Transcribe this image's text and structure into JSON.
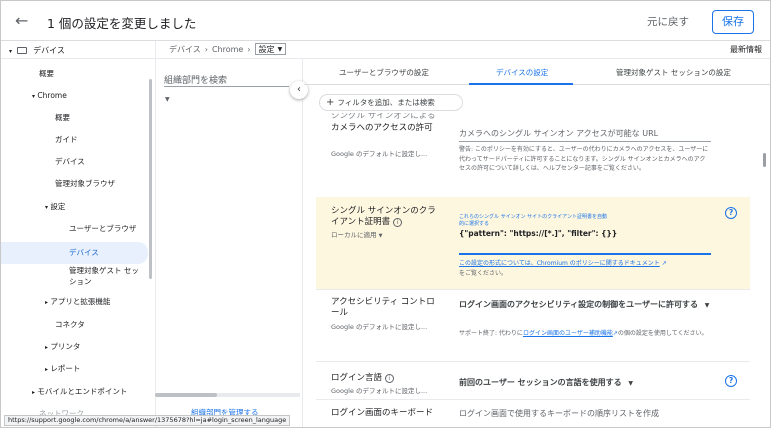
{
  "topbar": {
    "title": "1 個の設定を変更しました",
    "undo_label": "元に戻す",
    "save_label": "保存"
  },
  "breadcrumb": {
    "part1": "デバイス",
    "part2": "Chrome",
    "current": "設定"
  },
  "latest_info": "最新情報",
  "nav": {
    "devices": "デバイス",
    "overview": "概要",
    "chrome": "Chrome",
    "chrome_overview": "概要",
    "guide": "ガイド",
    "chrome_devices": "デバイス",
    "managed_browsers": "管理対象ブラウザ",
    "settings": "設定",
    "users_browsers": "ユーザーとブラウザ",
    "devices_settings": "デバイス",
    "managed_guest_1": "管理対象ゲスト セッ",
    "managed_guest_2": "ション",
    "apps_extensions": "アプリと拡張機能",
    "connectors": "コネクタ",
    "printers": "プリンタ",
    "reports": "レポート",
    "mobile_endpoints": "モバイルとエンドポイント",
    "network_partial": "ネットワーク"
  },
  "org": {
    "search_placeholder": "組織部門を検索",
    "manage_partial": "組織部門を管理する"
  },
  "tabs": {
    "tab1": "ユーザーとブラウザの設定",
    "tab2": "デバイスの設定",
    "tab3": "管理対象ゲスト セッションの設定"
  },
  "filter_label": "フィルタを追加、または検索",
  "settings": {
    "camera": {
      "name_partial": "シングル サインオンによる",
      "name_line2": "カメラへのアクセスの許可",
      "inherit": "Google のデフォルトに設定し...",
      "value": "カメラへのシングル サインオン アクセスが可能な URL",
      "warning": "警告: このポリシーを有効にすると、ユーザーの代わりにカメラへのアクセスを、ユーザーに代わってサードパーティに許可することになります。シングル サインオンとカメラへのアクセスの許可について詳しくは、ヘルプセンター記事をご覧ください。"
    },
    "cert": {
      "name": "シングル サインオンのクライアント証明書",
      "local": "ローカルに適用",
      "hint": "これらのシングル サインオン サイトのクライアント証明書を自動的に選択する",
      "value": "{\"pattern\": \"https://[*.]\", \"filter\": {}}",
      "doc_link": "この設定の形式については、Chromium のポリシーに関するドキュメント",
      "doc_suffix": "をご覧ください。"
    },
    "a11y": {
      "name": "アクセシビリティ コントロール",
      "inherit": "Google のデフォルトに設定し...",
      "value": "ログイン画面のアクセシビリティ設定の制御をユーザーに許可する",
      "support_prefix": "サポート終了: 代わりに",
      "support_link": "ログイン画面のユーザー補助機能",
      "support_suffix": "の個の設定を使用してください。"
    },
    "lang": {
      "name": "ログイン言語",
      "inherit": "Google のデフォルトに設定し...",
      "value": "前回のユーザー セッションの言語を使用する"
    },
    "keyboard": {
      "name": "ログイン画面のキーボード",
      "value": "ログイン画面で使用するキーボードの順序リストを作成"
    }
  },
  "status_url": "https://support.google.com/chrome/a/answer/1375678?hl=ja#login_screen_language"
}
